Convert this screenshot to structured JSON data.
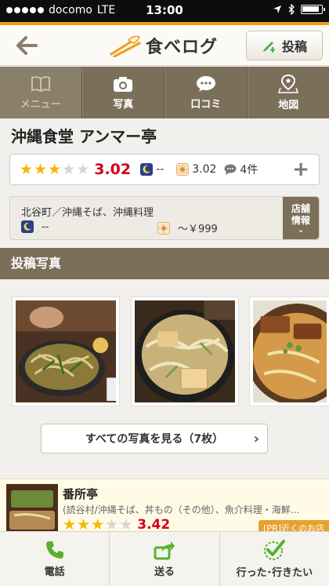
{
  "status": {
    "carrier": "docomo",
    "network": "LTE",
    "time": "13:00"
  },
  "header": {
    "logo_text": "食べログ",
    "post_label": "投稿"
  },
  "tabs": [
    {
      "label": "メニュー",
      "icon": "book-icon",
      "enabled": false
    },
    {
      "label": "写真",
      "icon": "camera-icon",
      "enabled": true
    },
    {
      "label": "口コミ",
      "icon": "speech-bubble-icon",
      "enabled": true
    },
    {
      "label": "地図",
      "icon": "map-pin-icon",
      "enabled": true
    }
  ],
  "restaurant": {
    "name": "沖縄食堂 アンマー亭",
    "stars": 3,
    "score": "3.02",
    "dinner_score": "--",
    "lunch_score": "3.02",
    "reviews": "4件",
    "area_category": "北谷町／沖縄そば、沖縄料理",
    "dinner_budget": "--",
    "lunch_budget": "～￥999",
    "store_info_label_1": "店舗",
    "store_info_label_2": "情報"
  },
  "photos_section": {
    "title": "投稿写真",
    "view_all": "すべての写真を見る（7枚）"
  },
  "nearby": {
    "name": "番所亭",
    "categories": "(読谷村/沖縄そば、丼もの（その他）、魚介料理・海鮮...",
    "stars": 3,
    "score": "3.42",
    "tag": "[PR]近くのお店"
  },
  "bottom_actions": [
    {
      "label": "電話",
      "icon": "phone-icon"
    },
    {
      "label": "送る",
      "icon": "share-icon"
    },
    {
      "label": "行った･行きたい",
      "icon": "checkmark-icon"
    }
  ],
  "colors": {
    "accent_orange": "#f39c12",
    "tab_brown": "#7b6f59",
    "score_red": "#d0021b",
    "star_gold": "#f5b800"
  }
}
